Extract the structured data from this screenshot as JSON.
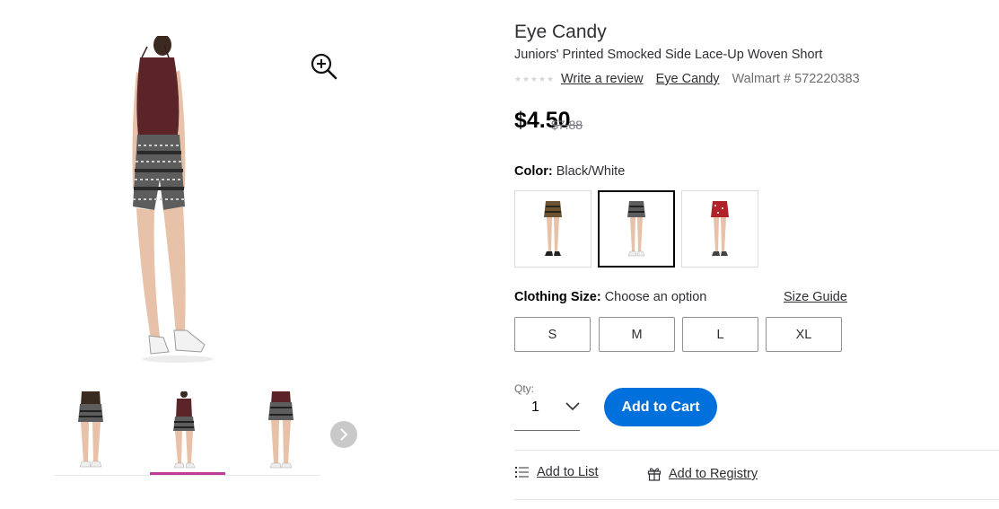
{
  "product": {
    "brand": "Eye Candy",
    "name": "Juniors' Printed Smocked Side Lace-Up Woven Short",
    "write_review": "Write a review",
    "brand_link": "Eye Candy",
    "walmart_number": "Walmart # 572220383",
    "rating_stars": 5,
    "price": "$4.50",
    "was_price": "$7.88"
  },
  "color": {
    "label": "Color:",
    "value": "Black/White",
    "swatches": [
      "Tan floral",
      "Black/White",
      "Red floral"
    ],
    "selected_index": 1
  },
  "size": {
    "label": "Clothing Size:",
    "prompt": "Choose an option",
    "guide_link": "Size Guide",
    "options": [
      "S",
      "M",
      "L",
      "XL"
    ]
  },
  "quantity": {
    "label": "Qty:",
    "value": "1"
  },
  "actions": {
    "add_to_cart": "Add to Cart",
    "add_to_list": "Add to List",
    "add_to_registry": "Add to Registry"
  },
  "gallery": {
    "selected_thumbnail": 1,
    "thumbnail_count": 3
  },
  "colors": {
    "primary_blue": "#0071dc",
    "thumb_underline": "#c13c96",
    "top_maroon": "#5a2428"
  },
  "icons": [
    "zoom-in-icon",
    "chevron-right-icon",
    "chevron-down-icon",
    "list-icon",
    "gift-icon",
    "star-icon"
  ]
}
